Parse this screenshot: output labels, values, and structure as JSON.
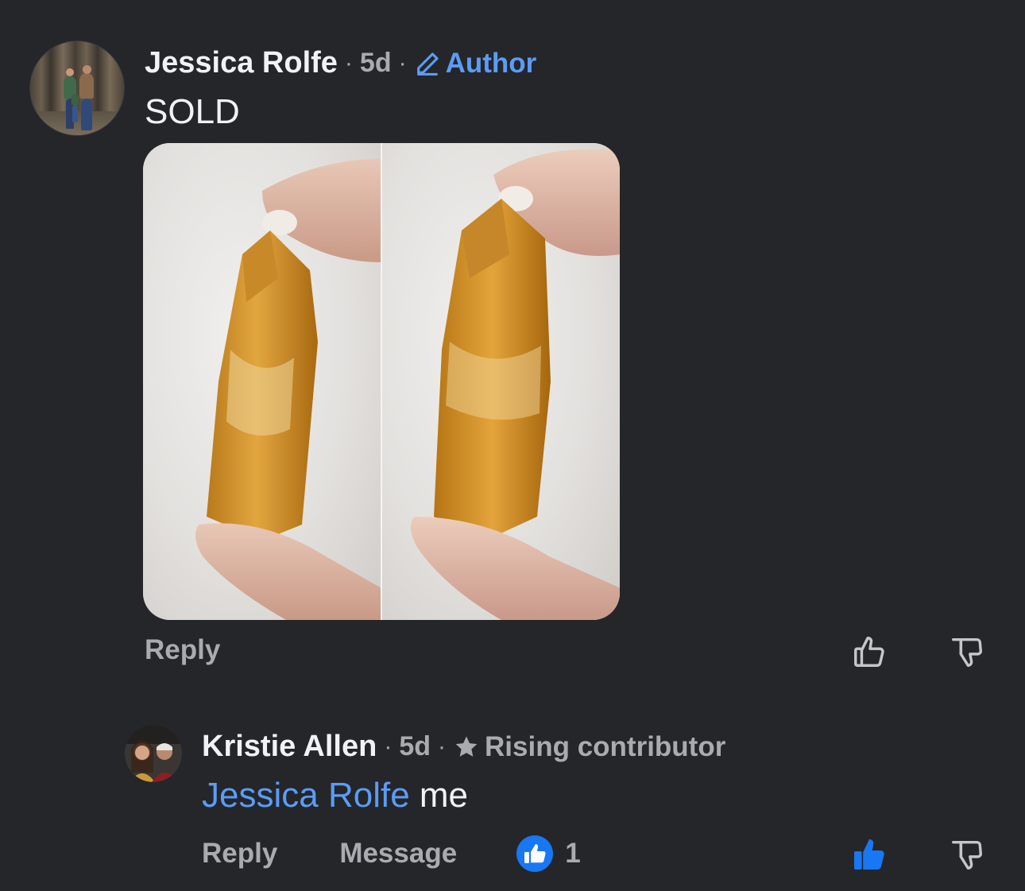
{
  "comments": [
    {
      "author": "Jessica Rolfe",
      "separator": "·",
      "time": "5d",
      "badge": "Author",
      "badge_icon": "pencil-icon",
      "text": "SOLD",
      "has_photo": true,
      "actions": {
        "reply": "Reply"
      },
      "vote_icons": [
        "thumbs-up-outline-icon",
        "thumbs-down-outline-icon"
      ]
    },
    {
      "author": "Kristie Allen",
      "separator": "·",
      "time": "5d",
      "badge": "Rising contributor",
      "badge_icon": "star-icon",
      "mention": "Jessica Rolfe",
      "text": " me",
      "actions": {
        "reply": "Reply",
        "message": "Message"
      },
      "like_count": "1",
      "vote_icons": [
        "thumbs-up-filled-icon",
        "thumbs-down-outline-icon"
      ]
    }
  ],
  "colors": {
    "background": "#252629",
    "accent_blue": "#5b9cf5",
    "like_blue": "#1877f2",
    "muted": "#a8abb0"
  }
}
